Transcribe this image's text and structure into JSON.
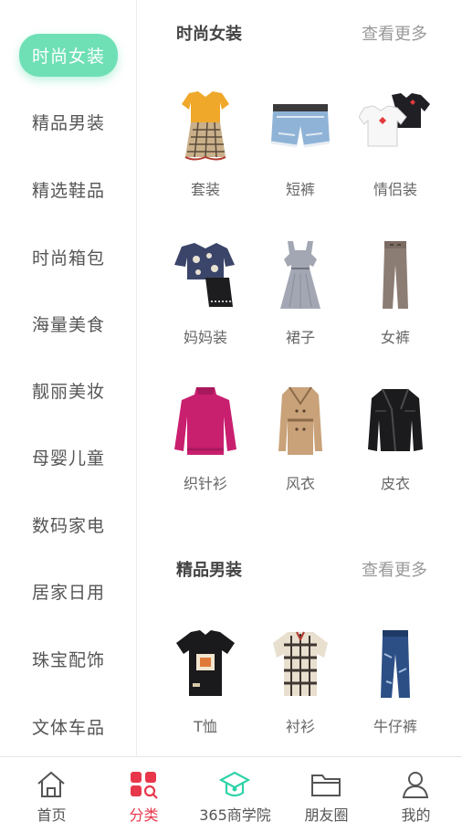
{
  "sidebar": {
    "items": [
      {
        "label": "时尚女装",
        "active": true
      },
      {
        "label": "精品男装"
      },
      {
        "label": "精选鞋品"
      },
      {
        "label": "时尚箱包"
      },
      {
        "label": "海量美食"
      },
      {
        "label": "靓丽美妆"
      },
      {
        "label": "母婴儿童"
      },
      {
        "label": "数码家电"
      },
      {
        "label": "居家日用"
      },
      {
        "label": "珠宝配饰"
      },
      {
        "label": "文体车品"
      }
    ],
    "active_color": "#6fe0b6"
  },
  "sections": [
    {
      "title": "时尚女装",
      "more": "查看更多",
      "products": [
        {
          "label": "套装",
          "icon": "outfit-set-icon"
        },
        {
          "label": "短裤",
          "icon": "denim-shorts-icon"
        },
        {
          "label": "情侣装",
          "icon": "couple-tshirts-icon"
        },
        {
          "label": "妈妈装",
          "icon": "mom-outfit-icon"
        },
        {
          "label": "裙子",
          "icon": "dress-icon"
        },
        {
          "label": "女裤",
          "icon": "trousers-icon"
        },
        {
          "label": "织针衫",
          "icon": "sweater-icon"
        },
        {
          "label": "风衣",
          "icon": "trench-coat-icon"
        },
        {
          "label": "皮衣",
          "icon": "leather-jacket-icon"
        }
      ]
    },
    {
      "title": "精品男装",
      "more": "查看更多",
      "products": [
        {
          "label": "T恤",
          "icon": "tshirt-icon"
        },
        {
          "label": "衬衫",
          "icon": "plaid-shirt-icon"
        },
        {
          "label": "牛仔裤",
          "icon": "jeans-icon"
        }
      ]
    }
  ],
  "tabbar": {
    "items": [
      {
        "label": "首页",
        "icon": "home-icon"
      },
      {
        "label": "分类",
        "icon": "category-icon",
        "active": true
      },
      {
        "label": "365商学院",
        "icon": "graduation-cap-icon"
      },
      {
        "label": "朋友圈",
        "icon": "folder-icon"
      },
      {
        "label": "我的",
        "icon": "user-icon"
      }
    ],
    "active_color": "#e8374b",
    "academy_color": "#2fd3a8"
  }
}
